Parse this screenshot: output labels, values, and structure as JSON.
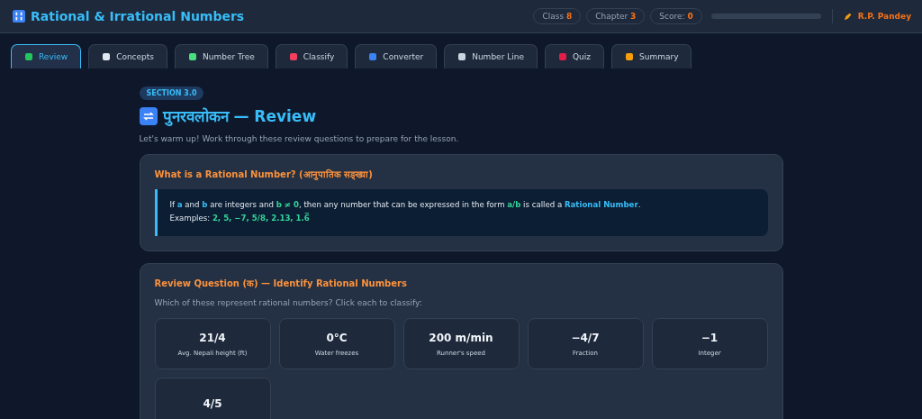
{
  "header": {
    "title": "Rational & Irrational Numbers",
    "badges": [
      {
        "label": "Class",
        "value": "8"
      },
      {
        "label": "Chapter",
        "value": "3"
      },
      {
        "label": "Score:",
        "value": "0"
      }
    ],
    "progress": {
      "level": 0
    },
    "author": "R.P. Pandey"
  },
  "tabs": [
    {
      "label": "Review",
      "selected": true
    },
    {
      "label": "Concepts",
      "selected": false
    },
    {
      "label": "Number Tree",
      "selected": false
    },
    {
      "label": "Classify",
      "selected": false
    },
    {
      "label": "Converter",
      "selected": false
    },
    {
      "label": "Number Line",
      "selected": false
    },
    {
      "label": "Quiz",
      "selected": false
    },
    {
      "label": "Summary",
      "selected": false
    }
  ],
  "section": {
    "badge": "SECTION 3.0",
    "title": "पुनरवलोकन — Review",
    "intro": "Let's warm up! Work through these review questions to prepare for the lesson."
  },
  "definition_card": {
    "title": "What is a Rational Number? (आनुपातिक सङ्ख्या)",
    "lines": [
      "If *a* and *b* are integers and **b ≠ 0**, then any number that can be expressed in the form **a/b** is called a *Rational Number*.",
      "Examples: **2, 5, −7, 5/8, 2.13, 1.6̅**"
    ]
  },
  "question_card": {
    "title": "Review Question (क) — Identify Rational Numbers",
    "prompt": "Which of these represent rational numbers? Click each to classify:",
    "items": [
      {
        "value": "21/4",
        "caption": "Avg. Nepali height (ft)"
      },
      {
        "value": "0°C",
        "caption": "Water freezes"
      },
      {
        "value": "200 m/min",
        "caption": "Runner's speed"
      },
      {
        "value": "−4/7",
        "caption": "Fraction"
      },
      {
        "value": "−1",
        "caption": "Integer"
      },
      {
        "value": "4/5"
      }
    ]
  }
}
